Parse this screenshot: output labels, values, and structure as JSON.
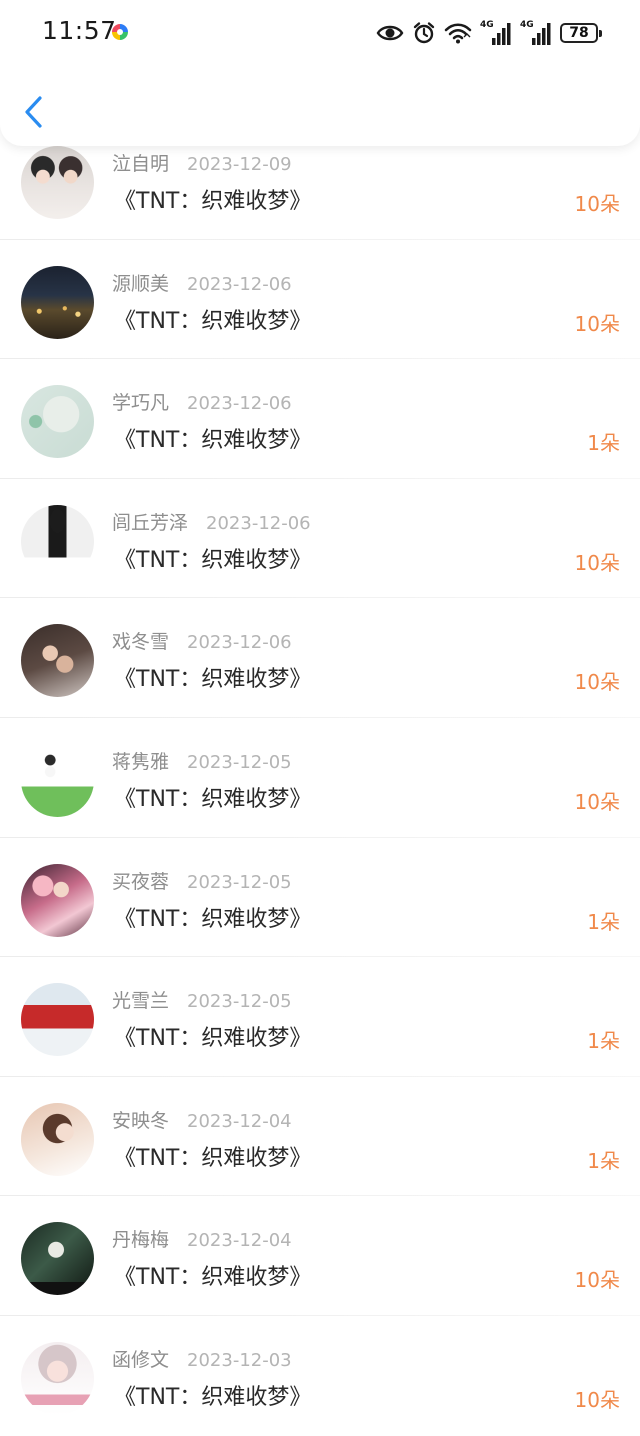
{
  "status_bar": {
    "time": "11:57",
    "battery": "78",
    "network_label_1": "4G",
    "network_label_2": "4G"
  },
  "header": {
    "back_icon": "chevron-left-icon",
    "accent_color": "#2a8cf0"
  },
  "colors": {
    "amount": "#f0894a",
    "name": "#8e8e8e",
    "date": "#b4b4b4",
    "title": "#2a2a2a"
  },
  "records": [
    {
      "name": "泣自明",
      "date": "2023-12-09",
      "title": "《TNT：织难收梦》",
      "amount": "10朵"
    },
    {
      "name": "源顺美",
      "date": "2023-12-06",
      "title": "《TNT：织难收梦》",
      "amount": "10朵"
    },
    {
      "name": "学巧凡",
      "date": "2023-12-06",
      "title": "《TNT：织难收梦》",
      "amount": "1朵"
    },
    {
      "name": "闾丘芳泽",
      "date": "2023-12-06",
      "title": "《TNT：织难收梦》",
      "amount": "10朵"
    },
    {
      "name": "戏冬雪",
      "date": "2023-12-06",
      "title": "《TNT：织难收梦》",
      "amount": "10朵"
    },
    {
      "name": "蒋隽雅",
      "date": "2023-12-05",
      "title": "《TNT：织难收梦》",
      "amount": "10朵"
    },
    {
      "name": "买夜蓉",
      "date": "2023-12-05",
      "title": "《TNT：织难收梦》",
      "amount": "1朵"
    },
    {
      "name": "光雪兰",
      "date": "2023-12-05",
      "title": "《TNT：织难收梦》",
      "amount": "1朵"
    },
    {
      "name": "安映冬",
      "date": "2023-12-04",
      "title": "《TNT：织难收梦》",
      "amount": "1朵"
    },
    {
      "name": "丹梅梅",
      "date": "2023-12-04",
      "title": "《TNT：织难收梦》",
      "amount": "10朵"
    },
    {
      "name": "函修文",
      "date": "2023-12-03",
      "title": "《TNT：织难收梦》",
      "amount": "10朵"
    }
  ]
}
